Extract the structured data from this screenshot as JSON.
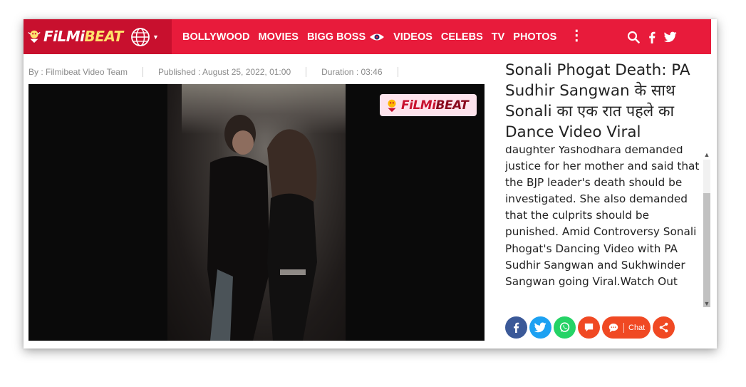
{
  "header": {
    "logo_part1": "FiLMi",
    "logo_part2": "BEAT",
    "nav": [
      {
        "label": "BOLLYWOOD"
      },
      {
        "label": "MOVIES"
      },
      {
        "label": "BIGG BOSS"
      },
      {
        "label": "VIDEOS"
      },
      {
        "label": "CELEBS"
      },
      {
        "label": "TV"
      },
      {
        "label": "PHOTOS"
      }
    ],
    "more": "⋮",
    "icons": [
      "globe-icon",
      "search-icon",
      "facebook-icon",
      "twitter-icon"
    ]
  },
  "meta": {
    "author": "By : Filmibeat Video Team",
    "published": "Published : August 25, 2022, 01:00",
    "duration": "Duration : 03:46"
  },
  "video": {
    "watermark_part1": "FiLMi",
    "watermark_part2": "BEAT"
  },
  "article": {
    "title": "Sonali Phogat Death: PA Sudhir Sangwan के साथ Sonali का एक रात पहले का Dance Video Viral",
    "description": "daughter Yashodhara demanded justice for her mother and said that the BJP leader's death should be investigated. She also demanded that the culprits should be punished. Amid Controversy Sonali Phogat's Dancing Video with PA Sudhir Sangwan and Sukhwinder Sangwan going Viral.Watch Out"
  },
  "share": {
    "chat_label": "Chat",
    "buttons": [
      {
        "name": "facebook",
        "color": "#3b5998"
      },
      {
        "name": "twitter",
        "color": "#1da1f2"
      },
      {
        "name": "whatsapp",
        "color": "#25d366"
      },
      {
        "name": "comment",
        "color": "#f04923"
      },
      {
        "name": "share",
        "color": "#f04923"
      }
    ]
  },
  "colors": {
    "brand_red": "#e81b3b",
    "brand_dark_red": "#c8102e"
  }
}
